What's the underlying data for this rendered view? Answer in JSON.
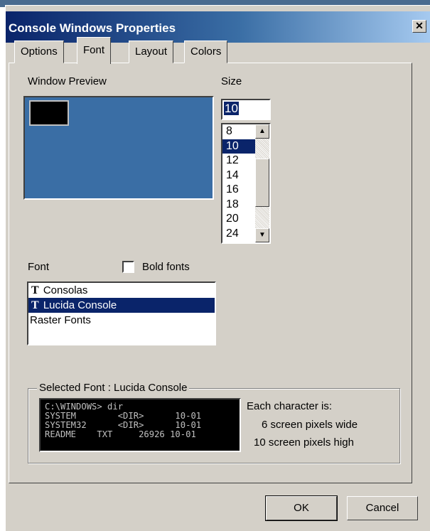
{
  "window": {
    "title": "Console Windows Properties",
    "close_glyph": "✕"
  },
  "tabs": [
    {
      "label": "Options"
    },
    {
      "label": "Font"
    },
    {
      "label": "Layout"
    },
    {
      "label": "Colors"
    }
  ],
  "active_tab": "Font",
  "window_preview": {
    "label": "Window Preview"
  },
  "size": {
    "label": "Size",
    "value": "10",
    "options": [
      "8",
      "10",
      "12",
      "14",
      "16",
      "18",
      "20",
      "24"
    ],
    "selected": "10"
  },
  "font": {
    "label": "Font",
    "bold_fonts_label": "Bold fonts",
    "bold_fonts_checked": false,
    "items": [
      {
        "name": "Consolas",
        "icon": "truetype-icon",
        "icon_glyph": "T"
      },
      {
        "name": "Lucida Console",
        "icon": "truetype-icon",
        "icon_glyph": "T"
      },
      {
        "name": "Raster Fonts",
        "icon": "",
        "icon_glyph": ""
      }
    ],
    "selected": "Lucida Console"
  },
  "selected_font": {
    "legend": "Selected Font : Lucida Console",
    "sample_lines": [
      "C:\\WINDOWS> dir",
      "SYSTEM        <DIR>      10-01",
      "SYSTEM32      <DIR>      10-01",
      "README    TXT     26926 10-01"
    ],
    "info_heading": "Each character is:",
    "info_width": "6 screen pixels wide",
    "info_height": "10 screen pixels high"
  },
  "buttons": {
    "ok": "OK",
    "cancel": "Cancel"
  },
  "colors": {
    "titlebar": "#0a246a",
    "dialog_face": "#d4d0c8",
    "selection": "#0a246a",
    "preview_desktop": "#3a6ea5"
  }
}
